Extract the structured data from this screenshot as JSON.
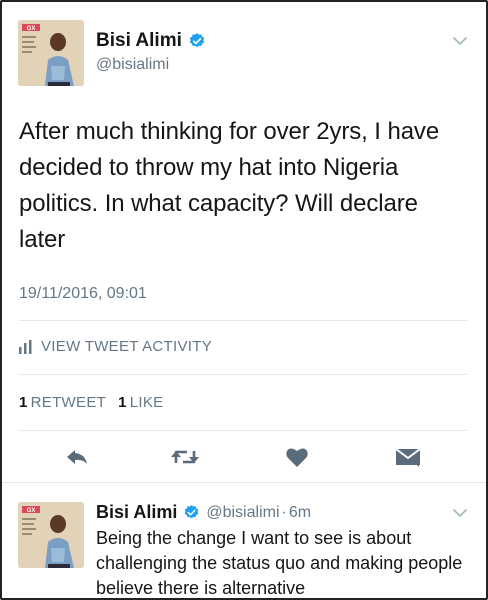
{
  "main_tweet": {
    "author_name": "Bisi Alimi",
    "author_handle": "@bisialimi",
    "text_lines": [
      "After much thinking for over 2yrs, I have",
      "decided to throw my hat into Nigeria",
      "politics. In what capacity? Will declare",
      "later"
    ],
    "timestamp": "19/11/2016, 09:01",
    "activity_label": "VIEW TWEET ACTIVITY",
    "retweet_count": "1",
    "retweet_label": "RETWEET",
    "like_count": "1",
    "like_label": "LIKE",
    "avatar_badge": "GX"
  },
  "reply_tweet": {
    "author_name": "Bisi Alimi",
    "author_handle": "@bisialimi",
    "separator": "·",
    "time_ago": "6m",
    "text": "Being the change I want to see is about challenging the status quo and making people believe there is alternative",
    "avatar_badge": "GX"
  },
  "icons": {
    "verified": "verified-badge-icon",
    "caret": "chevron-down-icon",
    "activity": "bar-chart-icon",
    "reply": "reply-arrow-icon",
    "retweet": "retweet-icon",
    "like": "heart-icon",
    "dm": "envelope-icon"
  },
  "colors": {
    "primary_text": "#14171a",
    "secondary_text": "#657786",
    "divider": "#e1e8ed",
    "verified": "#1da1f2",
    "action_icon": "#5a6b7c"
  }
}
